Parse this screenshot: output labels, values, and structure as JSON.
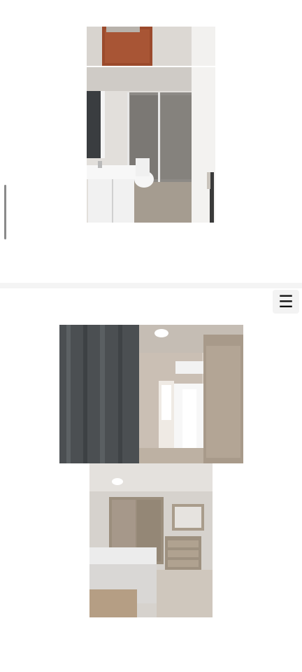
{
  "menu": {
    "icon": "hamburger-menu-icon",
    "glyph": "☰"
  },
  "gallery": {
    "section1": [
      "bathroom-vanity-top",
      "bathroom-shower"
    ],
    "section2": [
      "bedroom-curtain-door",
      "bedroom-wardrobe-bed"
    ]
  }
}
